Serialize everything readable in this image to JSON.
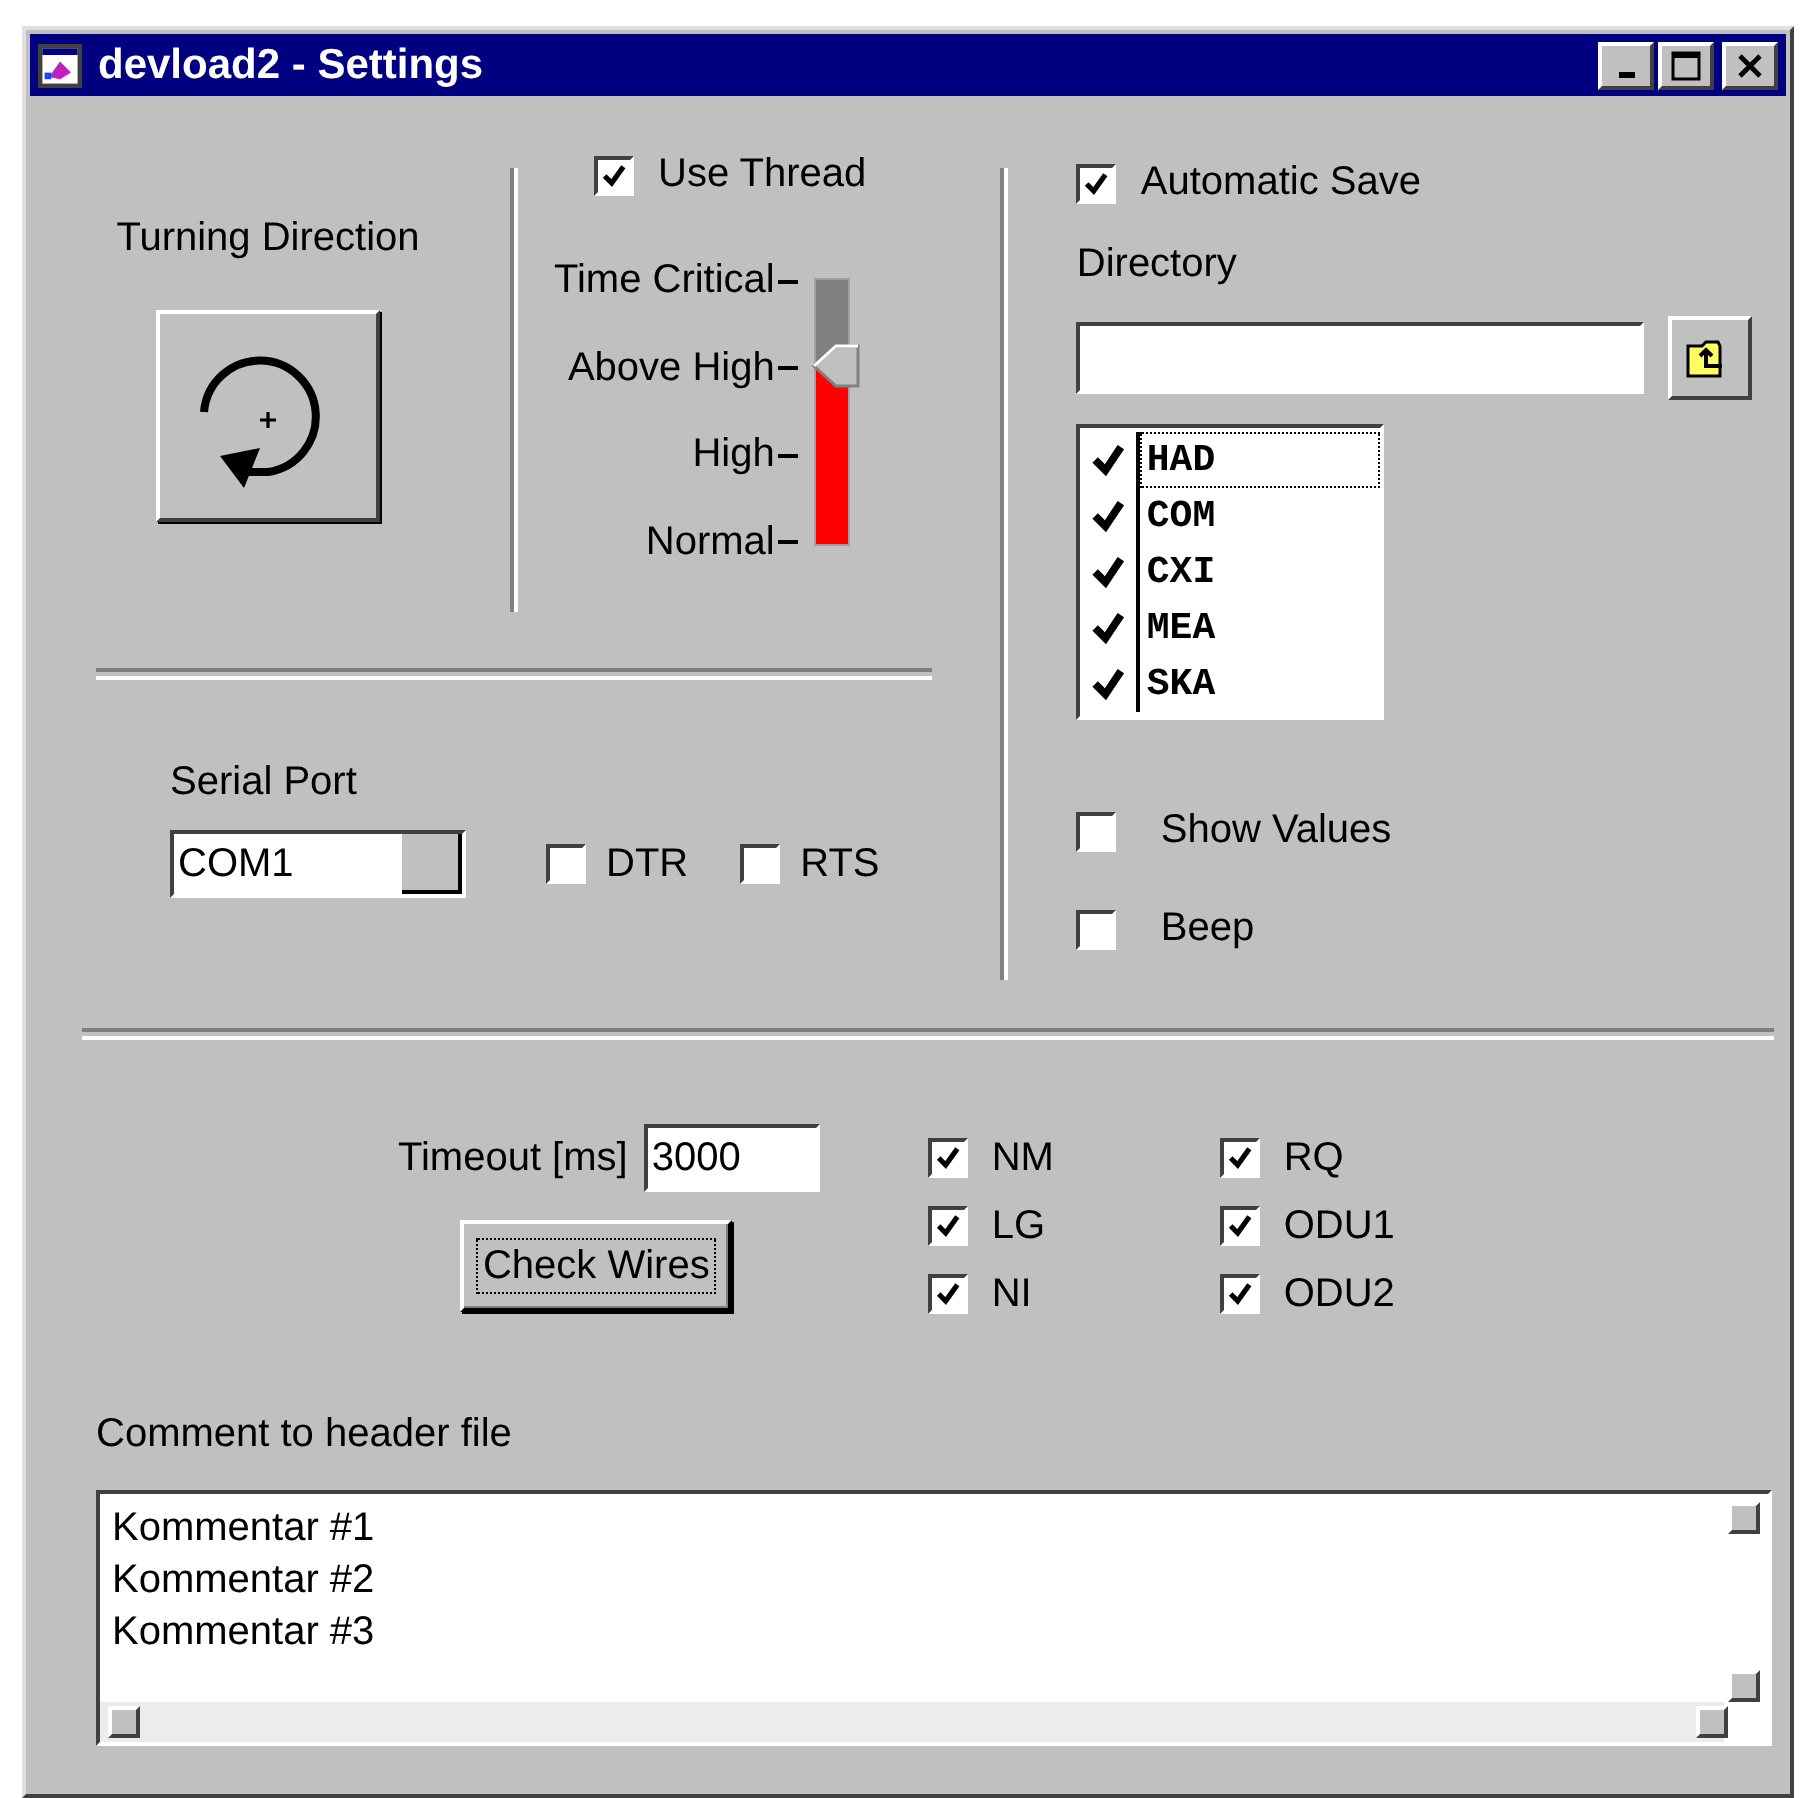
{
  "window": {
    "title": "devload2 - Settings"
  },
  "turning_direction": {
    "label": "Turning Direction"
  },
  "use_thread": {
    "label": "Use Thread",
    "checked": true
  },
  "priority": {
    "labels": [
      "Time Critical",
      "Above High",
      "High",
      "Normal"
    ],
    "level": 0.67
  },
  "serial_port": {
    "label": "Serial Port",
    "value": "COM1"
  },
  "port_options": [
    {
      "label": "DTR",
      "checked": false
    },
    {
      "label": "RTS",
      "checked": false
    }
  ],
  "automatic_save": {
    "label": "Automatic Save",
    "checked": true
  },
  "directory": {
    "label": "Directory"
  },
  "file_types": [
    {
      "label": "HAD",
      "checked": true,
      "selected": true
    },
    {
      "label": "COM",
      "checked": true,
      "selected": false
    },
    {
      "label": "CXI",
      "checked": true,
      "selected": false
    },
    {
      "label": "MEA",
      "checked": true,
      "selected": false
    },
    {
      "label": "SKA",
      "checked": true,
      "selected": false
    }
  ],
  "options": [
    {
      "label": "Show Values",
      "checked": false
    },
    {
      "label": "Beep",
      "checked": false
    }
  ],
  "timeout": {
    "label": "Timeout [ms]",
    "value": "3000"
  },
  "check_wires": {
    "label": "Check Wires"
  },
  "wires": [
    {
      "label": "NM",
      "checked": true
    },
    {
      "label": "LG",
      "checked": true
    },
    {
      "label": "NI",
      "checked": true
    },
    {
      "label": "RQ",
      "checked": true
    },
    {
      "label": "ODU1",
      "checked": true
    },
    {
      "label": "ODU2",
      "checked": true
    }
  ],
  "comment": {
    "label": "Comment to header file",
    "lines": [
      "Kommentar #1",
      "Kommentar #2",
      "Kommentar #3"
    ]
  }
}
